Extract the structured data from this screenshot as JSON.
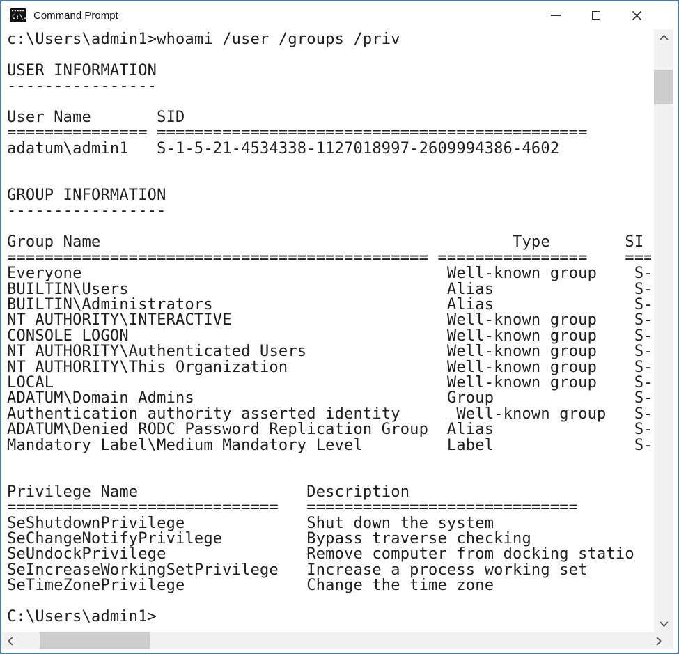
{
  "window": {
    "title": "Command Prompt",
    "controls": [
      "minimize",
      "maximize",
      "close"
    ]
  },
  "colors": {
    "border": "#4e7ca3",
    "titlebar_bg": "#ffffff",
    "console_bg": "#ffffff",
    "console_text": "#1e1e1e",
    "scrollbar_track": "#f1f1f1",
    "scrollbar_thumb": "#cdcdcd"
  },
  "console": {
    "lines": [
      "c:\\Users\\admin1>whoami /user /groups /priv",
      "",
      "USER INFORMATION",
      "----------------",
      "",
      {
        "cells": [
          {
            "col": 0,
            "text": "User Name"
          },
          {
            "col": 16,
            "text": "SID"
          }
        ]
      },
      {
        "cells": [
          {
            "col": 0,
            "text": "==============="
          },
          {
            "col": 16,
            "text": "=============================================="
          }
        ]
      },
      {
        "cells": [
          {
            "col": 0,
            "text": "adatum\\admin1"
          },
          {
            "col": 16,
            "text": "S-1-5-21-4534338-1127018997-2609994386-4602"
          }
        ]
      },
      "",
      "",
      "GROUP INFORMATION",
      "-----------------",
      "",
      {
        "cells": [
          {
            "col": 0,
            "text": "Group Name"
          },
          {
            "col": 54,
            "text": "Type"
          },
          {
            "col": 66,
            "text": "SI"
          }
        ]
      },
      {
        "cells": [
          {
            "col": 0,
            "text": "============================================="
          },
          {
            "col": 46,
            "text": "================"
          },
          {
            "col": 66,
            "text": "==="
          }
        ]
      },
      {
        "cells": [
          {
            "col": 0,
            "text": "Everyone"
          },
          {
            "col": 47,
            "text": "Well-known group"
          },
          {
            "col": 67,
            "text": "S-"
          }
        ]
      },
      {
        "cells": [
          {
            "col": 0,
            "text": "BUILTIN\\Users"
          },
          {
            "col": 47,
            "text": "Alias"
          },
          {
            "col": 67,
            "text": "S-"
          }
        ]
      },
      {
        "cells": [
          {
            "col": 0,
            "text": "BUILTIN\\Administrators"
          },
          {
            "col": 47,
            "text": "Alias"
          },
          {
            "col": 67,
            "text": "S-"
          }
        ]
      },
      {
        "cells": [
          {
            "col": 0,
            "text": "NT AUTHORITY\\INTERACTIVE"
          },
          {
            "col": 47,
            "text": "Well-known group"
          },
          {
            "col": 67,
            "text": "S-"
          }
        ]
      },
      {
        "cells": [
          {
            "col": 0,
            "text": "CONSOLE LOGON"
          },
          {
            "col": 47,
            "text": "Well-known group"
          },
          {
            "col": 67,
            "text": "S-"
          }
        ]
      },
      {
        "cells": [
          {
            "col": 0,
            "text": "NT AUTHORITY\\Authenticated Users"
          },
          {
            "col": 47,
            "text": "Well-known group"
          },
          {
            "col": 67,
            "text": "S-"
          }
        ]
      },
      {
        "cells": [
          {
            "col": 0,
            "text": "NT AUTHORITY\\This Organization"
          },
          {
            "col": 47,
            "text": "Well-known group"
          },
          {
            "col": 67,
            "text": "S-"
          }
        ]
      },
      {
        "cells": [
          {
            "col": 0,
            "text": "LOCAL"
          },
          {
            "col": 47,
            "text": "Well-known group"
          },
          {
            "col": 67,
            "text": "S-"
          }
        ]
      },
      {
        "cells": [
          {
            "col": 0,
            "text": "ADATUM\\Domain Admins"
          },
          {
            "col": 47,
            "text": "Group"
          },
          {
            "col": 67,
            "text": "S-"
          }
        ]
      },
      {
        "cells": [
          {
            "col": 0,
            "text": "Authentication authority asserted identity"
          },
          {
            "col": 48,
            "text": "Well-known group"
          },
          {
            "col": 67,
            "text": "S-"
          }
        ]
      },
      {
        "cells": [
          {
            "col": 0,
            "text": "ADATUM\\Denied RODC Password Replication Group"
          },
          {
            "col": 47,
            "text": "Alias"
          },
          {
            "col": 67,
            "text": "S-"
          }
        ]
      },
      {
        "cells": [
          {
            "col": 0,
            "text": "Mandatory Label\\Medium Mandatory Level"
          },
          {
            "col": 47,
            "text": "Label"
          },
          {
            "col": 67,
            "text": "S-"
          }
        ]
      },
      "",
      "",
      {
        "cells": [
          {
            "col": 0,
            "text": "Privilege Name"
          },
          {
            "col": 32,
            "text": "Description"
          }
        ]
      },
      {
        "cells": [
          {
            "col": 0,
            "text": "============================="
          },
          {
            "col": 32,
            "text": "============================="
          }
        ]
      },
      {
        "cells": [
          {
            "col": 0,
            "text": "SeShutdownPrivilege"
          },
          {
            "col": 32,
            "text": "Shut down the system"
          }
        ]
      },
      {
        "cells": [
          {
            "col": 0,
            "text": "SeChangeNotifyPrivilege"
          },
          {
            "col": 32,
            "text": "Bypass traverse checking"
          }
        ]
      },
      {
        "cells": [
          {
            "col": 0,
            "text": "SeUndockPrivilege"
          },
          {
            "col": 32,
            "text": "Remove computer from docking statio"
          }
        ]
      },
      {
        "cells": [
          {
            "col": 0,
            "text": "SeIncreaseWorkingSetPrivilege"
          },
          {
            "col": 32,
            "text": "Increase a process working set"
          }
        ]
      },
      {
        "cells": [
          {
            "col": 0,
            "text": "SeTimeZonePrivilege"
          },
          {
            "col": 32,
            "text": "Change the time zone"
          }
        ]
      },
      "",
      "C:\\Users\\admin1>"
    ]
  }
}
